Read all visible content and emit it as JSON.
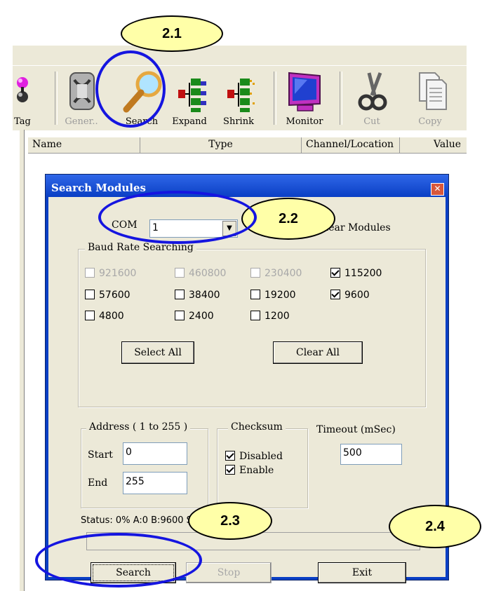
{
  "callouts": {
    "c21": "2.1",
    "c22": "2.2",
    "c23": "2.3",
    "c24": "2.4"
  },
  "toolbar": {
    "items": [
      {
        "label": "Tag",
        "icon": "tag-icon"
      },
      {
        "label": "Gener..",
        "icon": "generate-icon"
      },
      {
        "label": "Search",
        "icon": "search-icon"
      },
      {
        "label": "Expand",
        "icon": "expand-icon"
      },
      {
        "label": "Shrink",
        "icon": "shrink-icon"
      },
      {
        "label": "Monitor",
        "icon": "monitor-icon"
      },
      {
        "label": "Cut",
        "icon": "cut-icon"
      },
      {
        "label": "Copy",
        "icon": "copy-icon"
      }
    ]
  },
  "columns": [
    "Name",
    "Type",
    "Channel/Location",
    "Value"
  ],
  "dialog": {
    "title": "Search Modules",
    "com_label": "COM",
    "com_value": "1",
    "clear_modules_label": "Clear Modules",
    "baud_group": "Baud Rate Searching",
    "baud_rates": [
      {
        "label": "921600",
        "checked": false,
        "enabled": false
      },
      {
        "label": "460800",
        "checked": false,
        "enabled": false
      },
      {
        "label": "230400",
        "checked": false,
        "enabled": false
      },
      {
        "label": "115200",
        "checked": true,
        "enabled": true
      },
      {
        "label": "57600",
        "checked": false,
        "enabled": true
      },
      {
        "label": "38400",
        "checked": false,
        "enabled": true
      },
      {
        "label": "19200",
        "checked": false,
        "enabled": true
      },
      {
        "label": "9600",
        "checked": true,
        "enabled": true
      },
      {
        "label": "4800",
        "checked": false,
        "enabled": true
      },
      {
        "label": "2400",
        "checked": false,
        "enabled": true
      },
      {
        "label": "1200",
        "checked": false,
        "enabled": true
      }
    ],
    "select_all": "Select All",
    "clear_all": "Clear All",
    "address_group": "Address ( 1 to 255 )",
    "start_label": "Start",
    "start_value": "0",
    "end_label": "End",
    "end_value": "255",
    "checksum_group": "Checksum",
    "checksum_disabled": "Disabled",
    "checksum_enabled": "Enable",
    "timeout_label": "Timeout (mSec)",
    "timeout_value": "500",
    "status": "Status:  0% A:0 B:9600 S:1 FC:13",
    "search_btn": "Search",
    "stop_btn": "Stop",
    "exit_btn": "Exit"
  }
}
